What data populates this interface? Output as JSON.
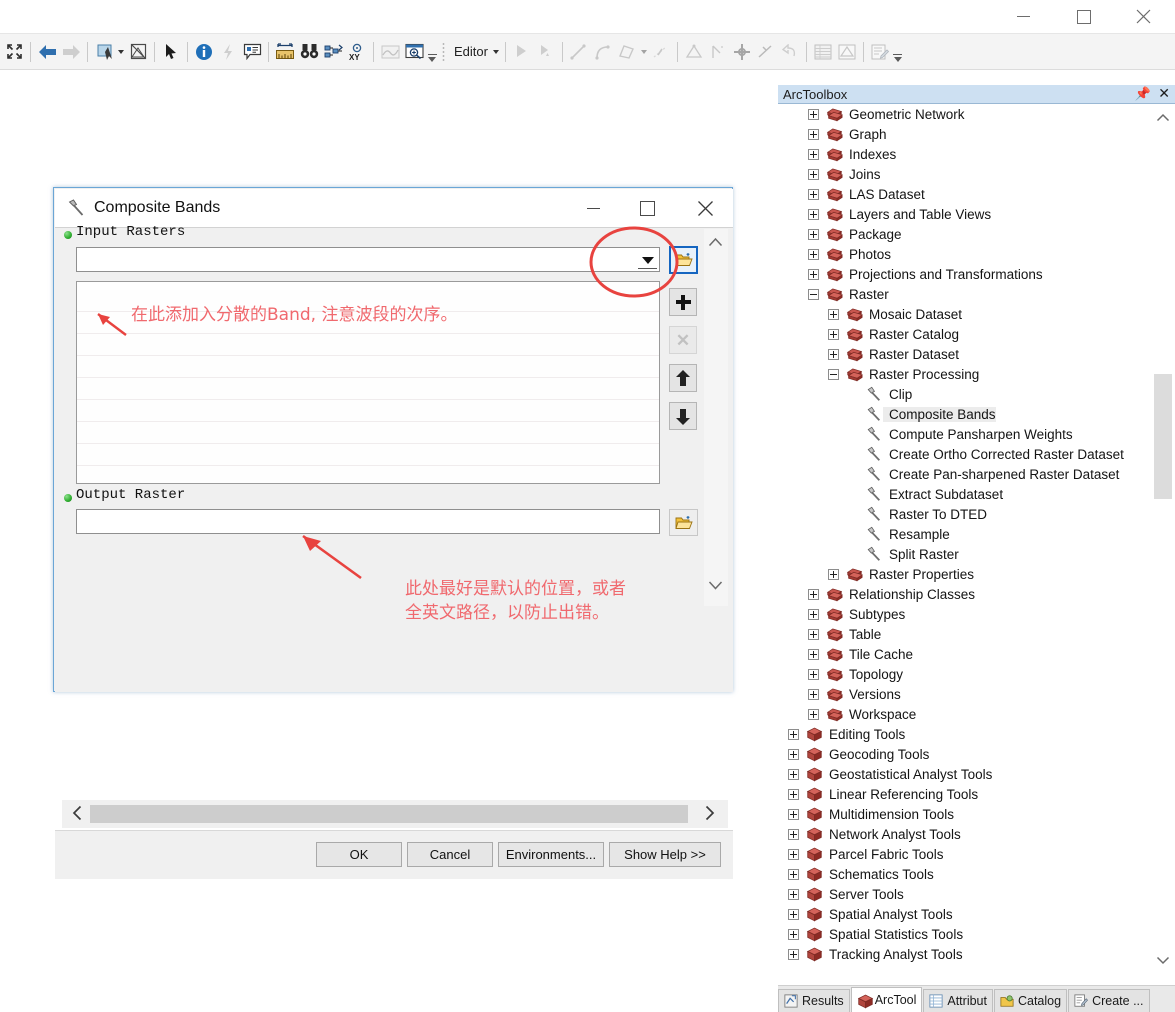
{
  "window": {
    "minimize": "minimize-icon",
    "maximize": "maximize-icon",
    "close": "close-icon"
  },
  "toolbar": {
    "editor_label": "Editor",
    "items": [
      {
        "name": "full-extent-icon"
      },
      {
        "name": "back-arrow-icon"
      },
      {
        "name": "forward-arrow-icon"
      },
      {
        "name": "select-features-icon"
      },
      {
        "name": "clear-selection-icon"
      },
      {
        "name": "select-elements-icon"
      },
      {
        "name": "identify-icon"
      },
      {
        "name": "hyperlink-icon"
      },
      {
        "name": "html-popup-icon"
      },
      {
        "name": "measure-icon"
      },
      {
        "name": "find-icon"
      },
      {
        "name": "find-route-icon"
      },
      {
        "name": "go-to-xy-icon"
      },
      {
        "name": "time-slider-icon"
      },
      {
        "name": "create-viewer-window-icon"
      },
      {
        "name": "sketch-tool-icon"
      },
      {
        "name": "edit-vertices-icon"
      },
      {
        "name": "straight-segment-icon"
      },
      {
        "name": "arc-segment-icon"
      },
      {
        "name": "trace-icon"
      },
      {
        "name": "midpoint-icon"
      },
      {
        "name": "distance-distance-icon"
      },
      {
        "name": "direction-distance-icon"
      },
      {
        "name": "intersection-icon"
      },
      {
        "name": "tangent-icon"
      },
      {
        "name": "undo-sketch-icon"
      },
      {
        "name": "attributes-icon"
      },
      {
        "name": "sketch-properties-icon"
      },
      {
        "name": "create-features-icon"
      }
    ]
  },
  "dialog": {
    "title": "Composite Bands",
    "title_icon": "hammer-tool-icon",
    "input_rasters_label": "Input Rasters",
    "input_rasters_value": "",
    "output_raster_label": "Output Raster",
    "output_raster_value": "",
    "browse_icon": "open-folder-icon",
    "buttons": {
      "add": "add-icon",
      "remove": "remove-icon",
      "move_up": "move-up-icon",
      "move_down": "move-down-icon",
      "browse_output": "open-folder-icon"
    },
    "footer": {
      "ok": "OK",
      "cancel": "Cancel",
      "environments": "Environments...",
      "show_help": "Show Help >>"
    },
    "scroll_up": "chevron-up-icon",
    "scroll_down": "chevron-down-icon",
    "scroll_left": "chevron-left-icon",
    "scroll_right": "chevron-right-icon"
  },
  "annotations": {
    "note1": "在此添加入分散的Band, 注意波段的次序。",
    "note2_line1": "此处最好是默认的位置，或者",
    "note2_line2": "全英文路径，以防止出错。",
    "color": "#f0696e"
  },
  "toolbox": {
    "title": "ArcToolbox",
    "pin": "pin-icon",
    "close": "close-icon",
    "tree": [
      {
        "label": "Geometric Network",
        "indent": 1,
        "toggle": "plus",
        "icon": "toolset-icon"
      },
      {
        "label": "Graph",
        "indent": 1,
        "toggle": "plus",
        "icon": "toolset-icon"
      },
      {
        "label": "Indexes",
        "indent": 1,
        "toggle": "plus",
        "icon": "toolset-icon"
      },
      {
        "label": "Joins",
        "indent": 1,
        "toggle": "plus",
        "icon": "toolset-icon"
      },
      {
        "label": "LAS Dataset",
        "indent": 1,
        "toggle": "plus",
        "icon": "toolset-icon"
      },
      {
        "label": "Layers and Table Views",
        "indent": 1,
        "toggle": "plus",
        "icon": "toolset-icon"
      },
      {
        "label": "Package",
        "indent": 1,
        "toggle": "plus",
        "icon": "toolset-icon"
      },
      {
        "label": "Photos",
        "indent": 1,
        "toggle": "plus",
        "icon": "toolset-icon"
      },
      {
        "label": "Projections and Transformations",
        "indent": 1,
        "toggle": "plus",
        "icon": "toolset-icon"
      },
      {
        "label": "Raster",
        "indent": 1,
        "toggle": "minus",
        "icon": "toolset-icon"
      },
      {
        "label": "Mosaic Dataset",
        "indent": 2,
        "toggle": "plus",
        "icon": "toolset-icon"
      },
      {
        "label": "Raster Catalog",
        "indent": 2,
        "toggle": "plus",
        "icon": "toolset-icon"
      },
      {
        "label": "Raster Dataset",
        "indent": 2,
        "toggle": "plus",
        "icon": "toolset-icon"
      },
      {
        "label": "Raster Processing",
        "indent": 2,
        "toggle": "minus",
        "icon": "toolset-icon"
      },
      {
        "label": "Clip",
        "indent": 3,
        "toggle": "none",
        "icon": "tool-icon"
      },
      {
        "label": "Composite Bands",
        "indent": 3,
        "toggle": "none",
        "icon": "tool-icon",
        "selected": true
      },
      {
        "label": "Compute Pansharpen Weights",
        "indent": 3,
        "toggle": "none",
        "icon": "tool-icon"
      },
      {
        "label": "Create Ortho Corrected Raster Dataset",
        "indent": 3,
        "toggle": "none",
        "icon": "tool-icon"
      },
      {
        "label": "Create Pan-sharpened Raster Dataset",
        "indent": 3,
        "toggle": "none",
        "icon": "tool-icon"
      },
      {
        "label": "Extract Subdataset",
        "indent": 3,
        "toggle": "none",
        "icon": "tool-icon"
      },
      {
        "label": "Raster To DTED",
        "indent": 3,
        "toggle": "none",
        "icon": "tool-icon"
      },
      {
        "label": "Resample",
        "indent": 3,
        "toggle": "none",
        "icon": "tool-icon"
      },
      {
        "label": "Split Raster",
        "indent": 3,
        "toggle": "none",
        "icon": "tool-icon"
      },
      {
        "label": "Raster Properties",
        "indent": 2,
        "toggle": "plus",
        "icon": "toolset-icon"
      },
      {
        "label": "Relationship Classes",
        "indent": 1,
        "toggle": "plus",
        "icon": "toolset-icon"
      },
      {
        "label": "Subtypes",
        "indent": 1,
        "toggle": "plus",
        "icon": "toolset-icon"
      },
      {
        "label": "Table",
        "indent": 1,
        "toggle": "plus",
        "icon": "toolset-icon"
      },
      {
        "label": "Tile Cache",
        "indent": 1,
        "toggle": "plus",
        "icon": "toolset-icon"
      },
      {
        "label": "Topology",
        "indent": 1,
        "toggle": "plus",
        "icon": "toolset-icon"
      },
      {
        "label": "Versions",
        "indent": 1,
        "toggle": "plus",
        "icon": "toolset-icon"
      },
      {
        "label": "Workspace",
        "indent": 1,
        "toggle": "plus",
        "icon": "toolset-icon"
      },
      {
        "label": "Editing Tools",
        "indent": 0,
        "toggle": "plus",
        "icon": "toolbox-icon"
      },
      {
        "label": "Geocoding Tools",
        "indent": 0,
        "toggle": "plus",
        "icon": "toolbox-icon"
      },
      {
        "label": "Geostatistical Analyst Tools",
        "indent": 0,
        "toggle": "plus",
        "icon": "toolbox-icon"
      },
      {
        "label": "Linear Referencing Tools",
        "indent": 0,
        "toggle": "plus",
        "icon": "toolbox-icon"
      },
      {
        "label": "Multidimension Tools",
        "indent": 0,
        "toggle": "plus",
        "icon": "toolbox-icon"
      },
      {
        "label": "Network Analyst Tools",
        "indent": 0,
        "toggle": "plus",
        "icon": "toolbox-icon"
      },
      {
        "label": "Parcel Fabric Tools",
        "indent": 0,
        "toggle": "plus",
        "icon": "toolbox-icon"
      },
      {
        "label": "Schematics Tools",
        "indent": 0,
        "toggle": "plus",
        "icon": "toolbox-icon"
      },
      {
        "label": "Server Tools",
        "indent": 0,
        "toggle": "plus",
        "icon": "toolbox-icon"
      },
      {
        "label": "Spatial Analyst Tools",
        "indent": 0,
        "toggle": "plus",
        "icon": "toolbox-icon"
      },
      {
        "label": "Spatial Statistics Tools",
        "indent": 0,
        "toggle": "plus",
        "icon": "toolbox-icon"
      },
      {
        "label": "Tracking Analyst Tools",
        "indent": 0,
        "toggle": "plus",
        "icon": "toolbox-icon"
      }
    ],
    "tabs": [
      {
        "label": "Results",
        "icon": "results-icon",
        "active": false
      },
      {
        "label": "ArcTool",
        "icon": "toolbox-icon",
        "active": true
      },
      {
        "label": "Attribut",
        "icon": "table-icon",
        "active": false
      },
      {
        "label": "Catalog",
        "icon": "catalog-icon",
        "active": false
      },
      {
        "label": "Create ...",
        "icon": "create-features-icon",
        "active": false
      }
    ]
  }
}
